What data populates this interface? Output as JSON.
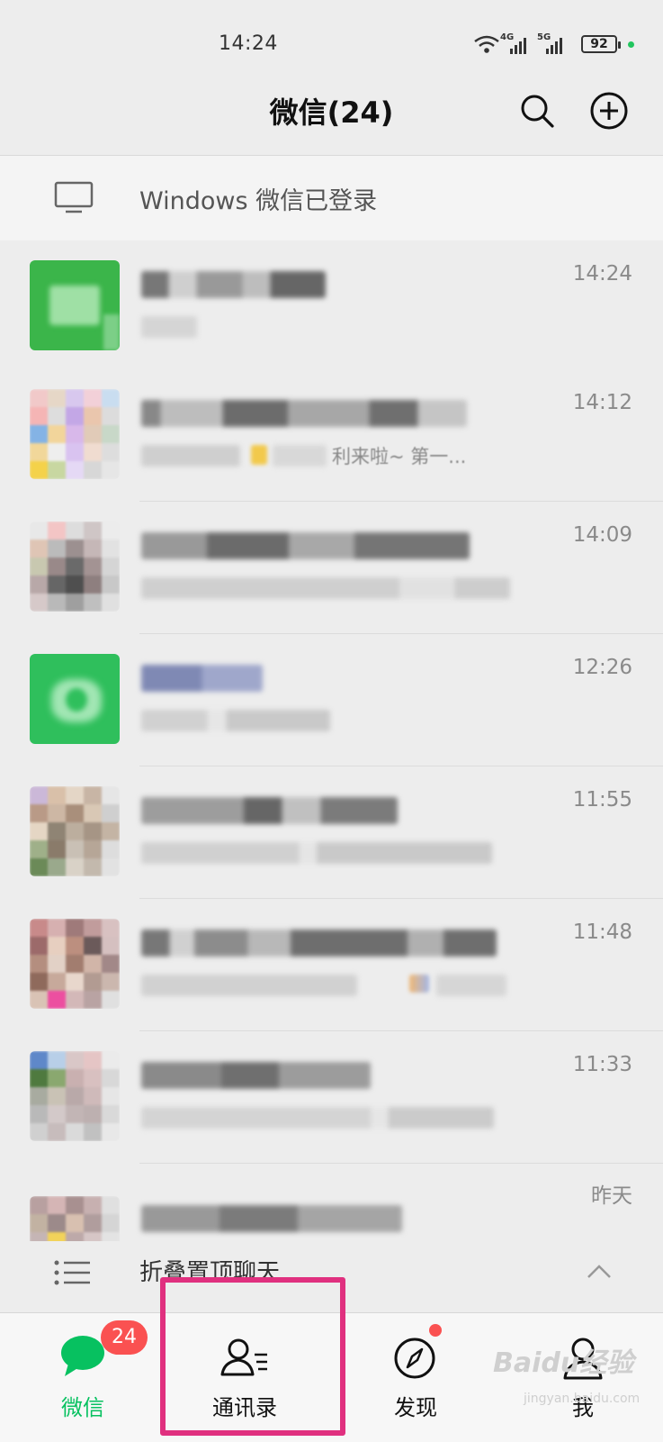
{
  "status_bar": {
    "time": "14:24",
    "signal1_label": "4G",
    "signal2_label": "5G",
    "battery": "92"
  },
  "header": {
    "title": "微信(24)",
    "search_icon": "search-icon",
    "add_icon": "plus-circle-icon"
  },
  "banner": {
    "text": "Windows 微信已登录",
    "icon": "monitor-icon"
  },
  "chats": [
    {
      "time": "14:24"
    },
    {
      "time": "14:12",
      "snippet": "利来啦~ 第一..."
    },
    {
      "time": "14:09"
    },
    {
      "time": "12:26"
    },
    {
      "time": "11:55"
    },
    {
      "time": "11:48"
    },
    {
      "time": "11:33"
    },
    {
      "time": "昨天"
    }
  ],
  "folded": {
    "label": "折叠置顶聊天",
    "icon": "list-icon",
    "chevron": "chevron-up-icon"
  },
  "tabs": [
    {
      "label": "微信",
      "badge": "24",
      "active": true,
      "icon": "chat-bubble-icon"
    },
    {
      "label": "通讯录",
      "icon": "contacts-icon"
    },
    {
      "label": "发现",
      "icon": "compass-icon",
      "dot": true
    },
    {
      "label": "我",
      "icon": "person-icon"
    }
  ],
  "watermark": {
    "text": "Baidu经验",
    "sub": "jingyan.baidu.com"
  },
  "colors": {
    "accent": "#07c160",
    "badge": "#fa5151",
    "highlight": "#e0307f"
  }
}
